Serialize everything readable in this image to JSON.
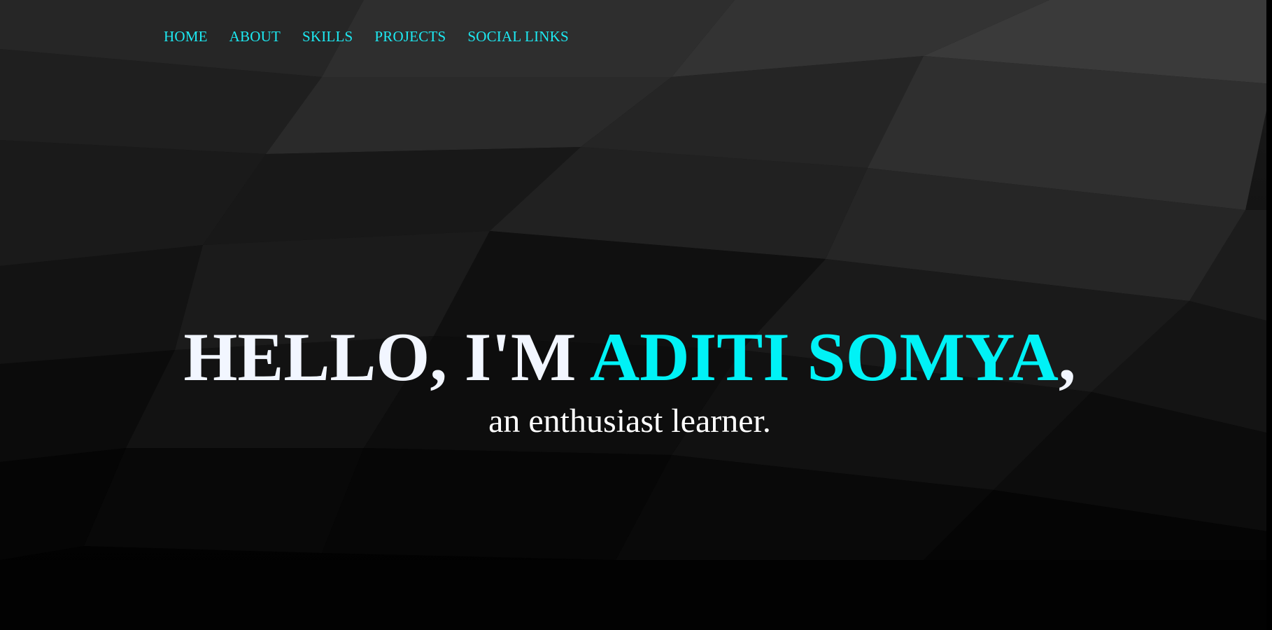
{
  "nav": {
    "items": [
      {
        "label": "HOME"
      },
      {
        "label": "ABOUT"
      },
      {
        "label": "SKILLS"
      },
      {
        "label": "PROJECTS"
      },
      {
        "label": "SOCIAL LINKS"
      }
    ]
  },
  "hero": {
    "greeting": "HELLO, I'M ",
    "name": "ADITI SOMYA",
    "trailing": ",",
    "tagline": "an enthusiast learner."
  },
  "colors": {
    "accent": "#00f2f6",
    "nav": "#1de9f2",
    "text": "#ffffff",
    "background": "#000000"
  }
}
